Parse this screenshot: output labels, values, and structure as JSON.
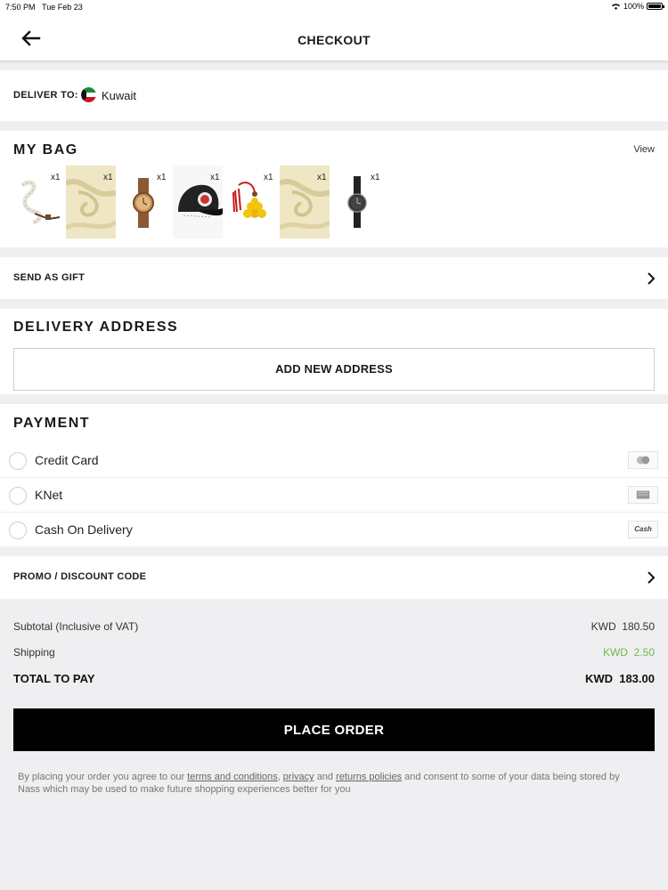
{
  "status_bar": {
    "time": "7:50 PM",
    "date": "Tue Feb 23",
    "battery": "100%"
  },
  "header": {
    "title": "CHECKOUT",
    "back_icon": "arrow-left-icon"
  },
  "deliver": {
    "label": "DELIVER TO:",
    "country": "Kuwait",
    "flag_icon": "kuwait-flag-icon"
  },
  "bag": {
    "title": "MY BAG",
    "view_label": "View",
    "items": [
      {
        "qty": "x1",
        "icon": "prayer-beads-image"
      },
      {
        "qty": "x1",
        "icon": "cream-fabric-image"
      },
      {
        "qty": "x1",
        "icon": "wooden-watch-image"
      },
      {
        "qty": "x1",
        "icon": "black-cap-image"
      },
      {
        "qty": "x1",
        "icon": "yellow-tassel-beads-image"
      },
      {
        "qty": "x1",
        "icon": "cream-fabric-image"
      },
      {
        "qty": "x1",
        "icon": "black-watch-image"
      }
    ]
  },
  "gift": {
    "label": "SEND AS GIFT"
  },
  "address": {
    "title": "DELIVERY ADDRESS",
    "add_button": "ADD NEW ADDRESS"
  },
  "payment": {
    "title": "PAYMENT",
    "methods": [
      {
        "name": "Credit Card",
        "icon": "credit-card-icon"
      },
      {
        "name": "KNet",
        "icon": "knet-icon"
      },
      {
        "name": "Cash On Delivery",
        "icon": "cash-icon",
        "logo_text": "Cash"
      }
    ]
  },
  "promo": {
    "label": "PROMO / DISCOUNT CODE"
  },
  "summary": {
    "subtotal_label": "Subtotal (Inclusive of VAT)",
    "subtotal_value": "KWD  180.50",
    "shipping_label": "Shipping",
    "shipping_value": "KWD  2.50",
    "total_label": "TOTAL TO PAY",
    "total_value": "KWD  183.00"
  },
  "place_order": "PLACE ORDER",
  "terms": {
    "prefix": "By placing your order you agree to our ",
    "terms_link": "terms and conditions",
    "comma": ", ",
    "privacy_link": "privacy",
    "and": " and ",
    "returns_link": "returns policies",
    "suffix": " and consent to some of your data being stored by Nass which may be used to make future shopping experiences better for you"
  },
  "colors": {
    "accent_green": "#6dbb4a",
    "button_black": "#000000",
    "background": "#efeff1"
  }
}
